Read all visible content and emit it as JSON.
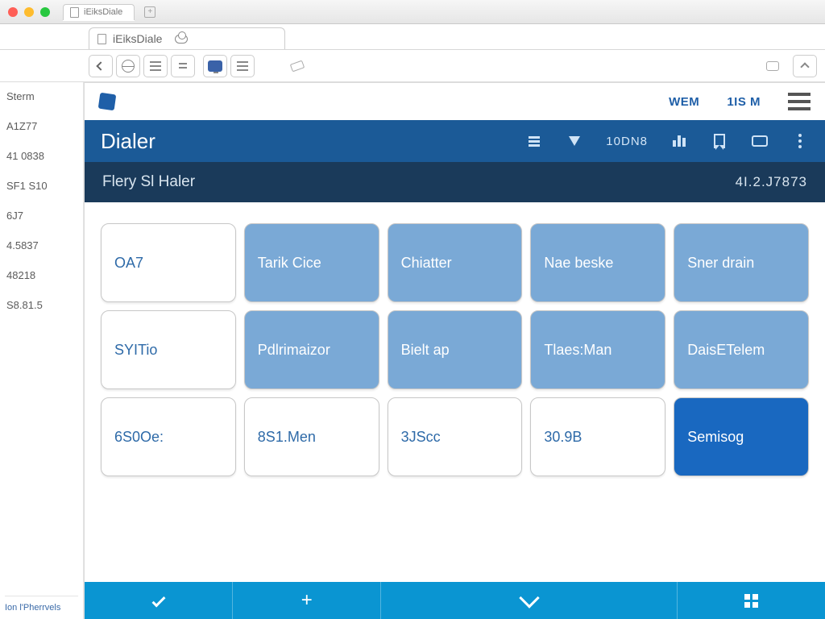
{
  "os": {
    "tab_label": "iEiksDiale"
  },
  "browser": {
    "tab_label": "iEiksDiale"
  },
  "left_rail": {
    "items": [
      "Sterm",
      "A1Z77",
      "41 0838",
      "SF1 S10",
      "6J7",
      "4.5837",
      "48218",
      "S8.81.5"
    ],
    "footer": "Ion l'Pherrvels"
  },
  "app_top": {
    "link1": "WEM",
    "link2": "1IS M"
  },
  "blue_bar": {
    "title": "Dialer",
    "count": "10DN8"
  },
  "dark_bar": {
    "left": "Flery Sl Haler",
    "right": "4I.2.J7873"
  },
  "tiles": [
    {
      "style": "white",
      "label": "OA7"
    },
    {
      "style": "light",
      "label": "Tarik Cice"
    },
    {
      "style": "light",
      "label": "Chiatter"
    },
    {
      "style": "light",
      "label": "Nae beske"
    },
    {
      "style": "light",
      "label": "Sner drain"
    },
    {
      "style": "white",
      "label": "SYITio"
    },
    {
      "style": "light",
      "label": "Pdlrimaizor"
    },
    {
      "style": "light",
      "label": "Bielt ap"
    },
    {
      "style": "light",
      "label": "Tlaes:Man"
    },
    {
      "style": "light",
      "label": "DaisETelem"
    },
    {
      "style": "white",
      "label": "6S0Oe:"
    },
    {
      "style": "white",
      "label": "8S1.Men"
    },
    {
      "style": "white",
      "label": "3JScc"
    },
    {
      "style": "white",
      "label": "30.9B"
    },
    {
      "style": "solid",
      "label": "Semisog"
    }
  ]
}
